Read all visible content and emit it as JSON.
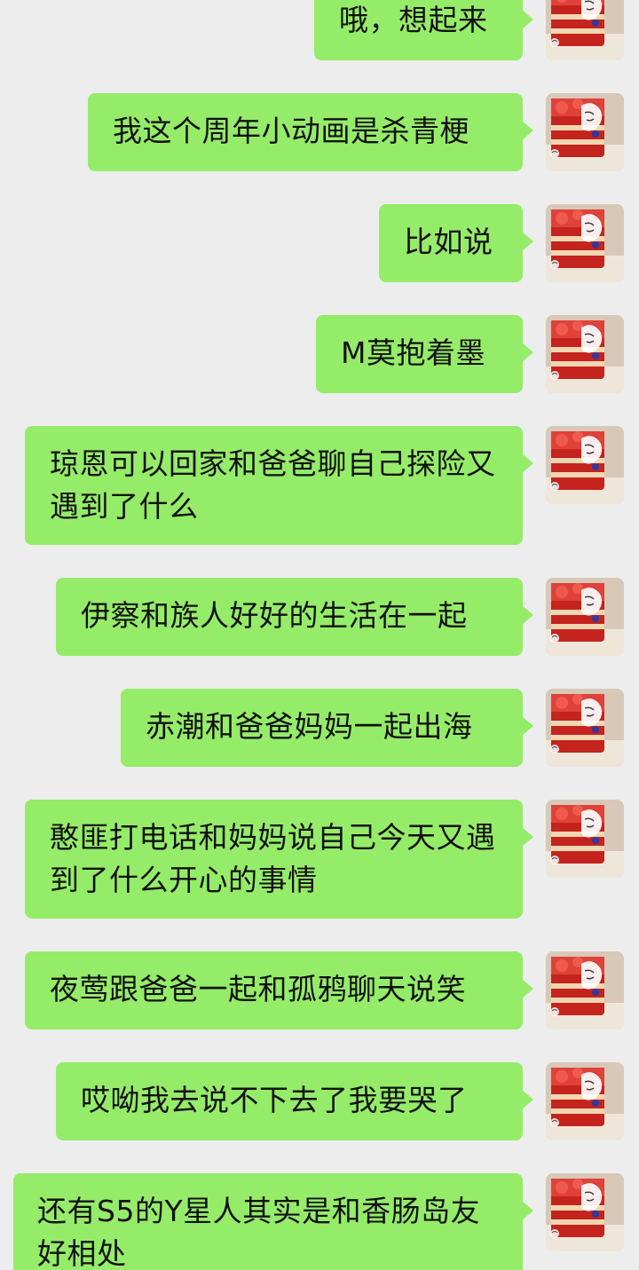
{
  "messages": [
    {
      "text": "哦，想起来"
    },
    {
      "text": "我这个周年小动画是杀青梗"
    },
    {
      "text": "比如说"
    },
    {
      "text": "M莫抱着墨"
    },
    {
      "text": "琼恩可以回家和爸爸聊自己探险又遇到了什么"
    },
    {
      "text": "伊察和族人好好的生活在一起"
    },
    {
      "text": "赤潮和爸爸妈妈一起出海"
    },
    {
      "text": "憨匪打电话和妈妈说自己今天又遇到了什么开心的事情"
    },
    {
      "text": "夜莺跟爸爸一起和孤鸦聊天说笑"
    },
    {
      "text": "哎呦我去说不下去了我要哭了"
    },
    {
      "text": "还有S5的Y星人其实是和香肠岛友好相处"
    }
  ],
  "avatar": {
    "icon": "strawberry-cake-avatar"
  },
  "colors": {
    "background": "#ededed",
    "bubble": "#95ec69",
    "text": "#111111"
  }
}
